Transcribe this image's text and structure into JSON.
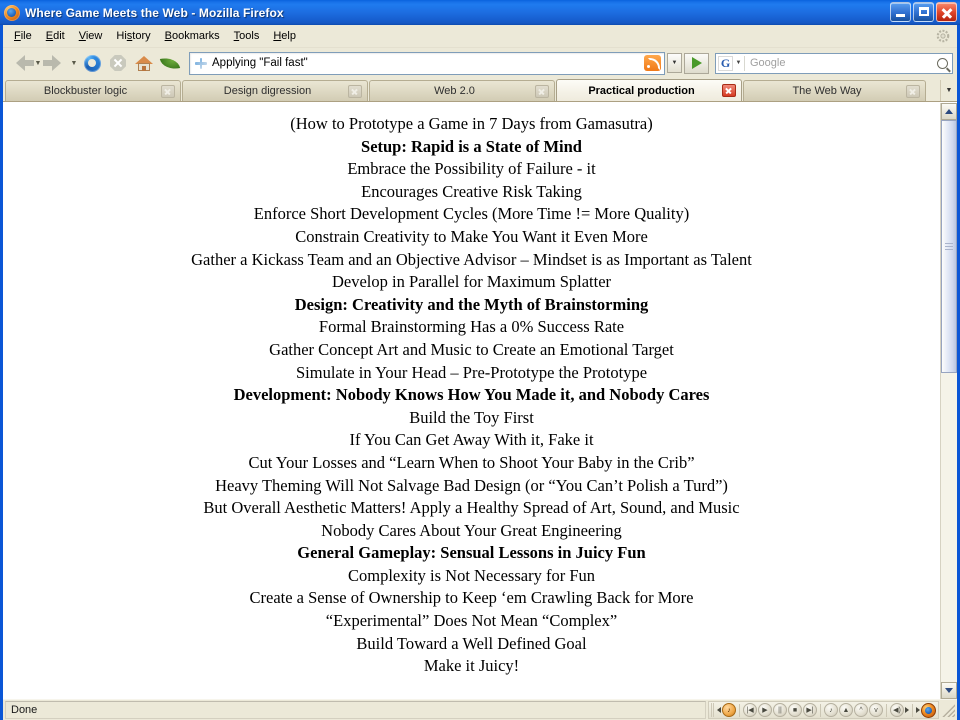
{
  "window": {
    "title": "Where Game Meets the Web - Mozilla Firefox",
    "icon": "firefox-icon",
    "controls": {
      "minimize": "Minimize",
      "maximize": "Maximize",
      "close": "Close"
    }
  },
  "menubar": {
    "items": [
      {
        "label": "File",
        "accel": "F"
      },
      {
        "label": "Edit",
        "accel": "E"
      },
      {
        "label": "View",
        "accel": "V"
      },
      {
        "label": "History",
        "accel": "s"
      },
      {
        "label": "Bookmarks",
        "accel": "B"
      },
      {
        "label": "Tools",
        "accel": "T"
      },
      {
        "label": "Help",
        "accel": "H"
      }
    ]
  },
  "toolbar": {
    "back": "Back",
    "forward": "Forward",
    "reload": "Reload",
    "stop": "Stop",
    "home": "Home",
    "bookmark_leaf": "leaf-bookmark",
    "address_value": "Applying \"Fail fast\"",
    "rss": "rss-feed",
    "go": "Go",
    "search_engine": "G",
    "search_placeholder": "Google"
  },
  "tabs": [
    {
      "label": "Blockbuster logic",
      "active": false
    },
    {
      "label": "Design digression",
      "active": false
    },
    {
      "label": "Web 2.0",
      "active": false
    },
    {
      "label": "Practical production",
      "active": true
    },
    {
      "label": "The Web Way",
      "active": false
    }
  ],
  "page": {
    "lines": [
      {
        "text": "(How to Prototype a Game in 7 Days from Gamasutra)",
        "bold": false
      },
      {
        "text": "Setup: Rapid is a State of Mind",
        "bold": true
      },
      {
        "text": "Embrace the Possibility of Failure - it",
        "bold": false
      },
      {
        "text": "Encourages Creative Risk Taking",
        "bold": false
      },
      {
        "text": "Enforce Short Development Cycles (More Time != More Quality)",
        "bold": false
      },
      {
        "text": "Constrain Creativity to Make You Want it Even More",
        "bold": false
      },
      {
        "text": "Gather a Kickass Team and an Objective Advisor – Mindset is as Important as Talent",
        "bold": false
      },
      {
        "text": "Develop in Parallel for Maximum Splatter",
        "bold": false
      },
      {
        "text": "Design: Creativity and the Myth of Brainstorming",
        "bold": true
      },
      {
        "text": "Formal Brainstorming Has a 0% Success Rate",
        "bold": false
      },
      {
        "text": "Gather Concept Art and Music to Create an Emotional Target",
        "bold": false
      },
      {
        "text": "Simulate in Your Head – Pre-Prototype the Prototype",
        "bold": false
      },
      {
        "text": "Development: Nobody Knows How You Made it, and Nobody Cares",
        "bold": true
      },
      {
        "text": "Build the Toy First",
        "bold": false
      },
      {
        "text": "If You Can Get Away With it, Fake it",
        "bold": false
      },
      {
        "text": "Cut Your Losses and “Learn When to Shoot Your Baby in the Crib”",
        "bold": false
      },
      {
        "text": "Heavy Theming Will Not Salvage Bad Design (or “You Can’t Polish a Turd”)",
        "bold": false
      },
      {
        "text": "But Overall Aesthetic Matters! Apply a Healthy Spread of Art, Sound, and Music",
        "bold": false
      },
      {
        "text": "Nobody Cares About Your Great Engineering",
        "bold": false
      },
      {
        "text": "General Gameplay: Sensual Lessons in Juicy Fun",
        "bold": true
      },
      {
        "text": "Complexity is Not Necessary for Fun",
        "bold": false
      },
      {
        "text": "Create a Sense of Ownership to Keep ‘em Crawling Back for More",
        "bold": false
      },
      {
        "text": "“Experimental” Does Not Mean “Complex”",
        "bold": false
      },
      {
        "text": "Build Toward a Well Defined Goal",
        "bold": false
      },
      {
        "text": "Make it Juicy!",
        "bold": false
      }
    ]
  },
  "statusbar": {
    "status": "Done",
    "media_controls": [
      "music-note-icon",
      "previous-track-icon",
      "play-icon",
      "pause-icon",
      "stop-icon",
      "next-track-icon",
      "note-small-icon",
      "eject-icon",
      "volume-up-icon",
      "volume-down-icon",
      "speaker-icon",
      "firefox-icon"
    ]
  },
  "colors": {
    "titlebar_blue": "#1f7bef",
    "chrome_beige": "#ece9d8",
    "close_red": "#d63a22",
    "accent_green": "#4a9a2a"
  }
}
